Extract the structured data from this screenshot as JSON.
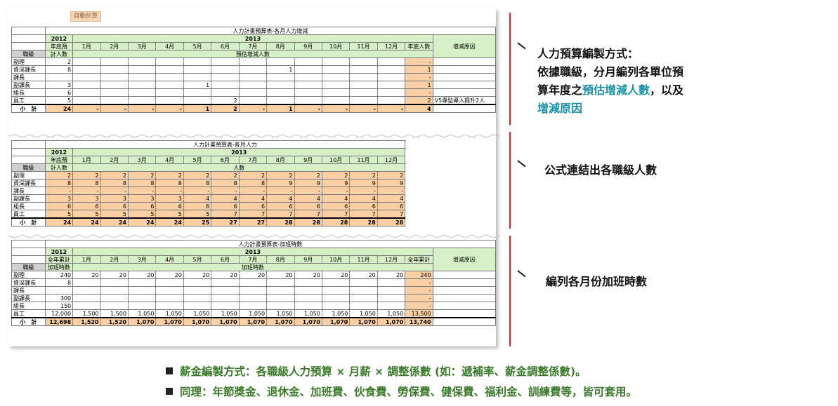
{
  "button": "自動計算",
  "months": [
    "1月",
    "2月",
    "3月",
    "4月",
    "5月",
    "6月",
    "7月",
    "8月",
    "9月",
    "10月",
    "11月",
    "12月"
  ],
  "t1": {
    "title": "人力計畫預算表-各月人力增減",
    "y0": "2012",
    "y1": "2013",
    "prev_l1": "年底預",
    "prev_l2": "計人數",
    "end_col": "年底人數",
    "reason_col": "增減原因",
    "rank_col": "職級",
    "group": "預估增減人數",
    "rows": [
      {
        "rank": "副理",
        "prev": "2",
        "m": [
          "",
          "",
          "",
          "",
          "",
          "",
          "",
          "",
          "",
          "",
          "",
          ""
        ],
        "end": "-",
        "reason": ""
      },
      {
        "rank": "資深課長",
        "prev": "8",
        "m": [
          "",
          "",
          "",
          "",
          "",
          "",
          "",
          "1",
          "",
          "",
          "",
          ""
        ],
        "end": "1",
        "reason": ""
      },
      {
        "rank": "課長",
        "prev": "",
        "m": [
          "",
          "",
          "",
          "",
          "",
          "",
          "",
          "",
          "",
          "",
          "",
          ""
        ],
        "end": "-",
        "reason": ""
      },
      {
        "rank": "副課長",
        "prev": "3",
        "m": [
          "",
          "",
          "",
          "",
          "1",
          "",
          "",
          "",
          "",
          "",
          "",
          ""
        ],
        "end": "1",
        "reason": ""
      },
      {
        "rank": "組長",
        "prev": "6",
        "m": [
          "",
          "",
          "",
          "",
          "",
          "",
          "",
          "",
          "",
          "",
          "",
          ""
        ],
        "end": "-",
        "reason": ""
      },
      {
        "rank": "員工",
        "prev": "5",
        "m": [
          "",
          "",
          "",
          "",
          "",
          "2",
          "",
          "",
          "",
          "",
          "",
          ""
        ],
        "end": "2",
        "reason": "V5專型導入提升2人"
      }
    ],
    "sub": {
      "label": "小　計",
      "prev": "24",
      "m": [
        "-",
        "-",
        "-",
        "-",
        "1",
        "2",
        "-",
        "1",
        "-",
        "-",
        "-",
        "-"
      ],
      "end": "4"
    }
  },
  "t2": {
    "title": "人力計畫預算表-各月人力",
    "y0": "2012",
    "y1": "2013",
    "prev_l1": "年底預",
    "prev_l2": "計人數",
    "rank_col": "職級",
    "group": "人數",
    "rows": [
      {
        "rank": "副理",
        "prev": "2",
        "m": [
          "2",
          "2",
          "2",
          "2",
          "2",
          "2",
          "2",
          "2",
          "2",
          "2",
          "2",
          "2"
        ]
      },
      {
        "rank": "資深課長",
        "prev": "8",
        "m": [
          "8",
          "8",
          "8",
          "8",
          "8",
          "8",
          "8",
          "9",
          "9",
          "9",
          "9",
          "9"
        ]
      },
      {
        "rank": "課長",
        "prev": "-",
        "m": [
          "-",
          "-",
          "-",
          "-",
          "-",
          "-",
          "-",
          "-",
          "-",
          "-",
          "-",
          "-"
        ]
      },
      {
        "rank": "副課長",
        "prev": "3",
        "m": [
          "3",
          "3",
          "3",
          "3",
          "4",
          "4",
          "4",
          "4",
          "4",
          "4",
          "4",
          "4"
        ]
      },
      {
        "rank": "組長",
        "prev": "6",
        "m": [
          "6",
          "6",
          "6",
          "6",
          "6",
          "6",
          "6",
          "6",
          "6",
          "6",
          "6",
          "6"
        ]
      },
      {
        "rank": "員工",
        "prev": "5",
        "m": [
          "5",
          "5",
          "5",
          "5",
          "5",
          "7",
          "7",
          "7",
          "7",
          "7",
          "7",
          "7"
        ]
      }
    ],
    "sub": {
      "label": "小　計",
      "prev": "24",
      "m": [
        "24",
        "24",
        "24",
        "24",
        "25",
        "27",
        "27",
        "28",
        "28",
        "28",
        "28",
        "28"
      ]
    }
  },
  "t3": {
    "title": "人力計畫預算表-加班時數",
    "y0": "2012",
    "y1": "2013",
    "prev_l1": "全年累計",
    "prev_l2": "加班時數",
    "total_col": "全年累計",
    "reason_col": "增減原因",
    "rank_col": "職級",
    "group": "加班時數",
    "rows": [
      {
        "rank": "副理",
        "prev": "240",
        "m": [
          "20",
          "20",
          "20",
          "20",
          "20",
          "20",
          "20",
          "20",
          "20",
          "20",
          "20",
          "20"
        ],
        "total": "240"
      },
      {
        "rank": "資深課長",
        "prev": "8",
        "m": [
          "",
          "",
          "",
          "",
          "",
          "",
          "",
          "",
          "",
          "",
          "",
          ""
        ],
        "total": "-"
      },
      {
        "rank": "課長",
        "prev": "",
        "m": [
          "",
          "",
          "",
          "",
          "",
          "",
          "",
          "",
          "",
          "",
          "",
          ""
        ],
        "total": "-"
      },
      {
        "rank": "副課長",
        "prev": "300",
        "m": [
          "",
          "",
          "",
          "",
          "",
          "",
          "",
          "",
          "",
          "",
          "",
          ""
        ],
        "total": "-"
      },
      {
        "rank": "組長",
        "prev": "150",
        "m": [
          "",
          "",
          "",
          "",
          "",
          "",
          "",
          "",
          "",
          "",
          "",
          ""
        ],
        "total": "-"
      },
      {
        "rank": "員工",
        "prev": "12,000",
        "m": [
          "1,500",
          "1,500",
          "1,050",
          "1,050",
          "1,050",
          "1,050",
          "1,050",
          "1,050",
          "1,050",
          "1,050",
          "1,050",
          "1,050"
        ],
        "total": "13,500"
      }
    ],
    "sub": {
      "label": "小　計",
      "prev": "12,698",
      "m": [
        "1,520",
        "1,520",
        "1,070",
        "1,070",
        "1,070",
        "1,070",
        "1,070",
        "1,070",
        "1,070",
        "1,070",
        "1,070",
        "1,070"
      ],
      "total": "13,740"
    }
  },
  "notes": {
    "n1_l1": "人力預算編製方式：",
    "n1_l2": "依據職級，分月編列各單位預",
    "n1_l3a": "算年度之",
    "n1_l3b": "預估增減人數",
    "n1_l3c": "，以及",
    "n1_l4": "增減原因",
    "n2": "公式連結出各職級人數",
    "n3": "編列各月份加班時數"
  },
  "bullets": [
    "薪金編製方式：各職級人力預算 × 月薪 × 調整係數 (如：遞補率、薪金調整係數)。",
    "同理：年節獎金、退休金、加班費、伙食費、勞保費、健保費、福利金、訓練費等，皆可套用。"
  ],
  "colors": {
    "header_green": "#d8f0c8",
    "highlight_orange": "#fbcfa4",
    "accent_red": "#e0202a",
    "teal": "#1a8fa6",
    "bullet_green": "#3a7a2a"
  }
}
